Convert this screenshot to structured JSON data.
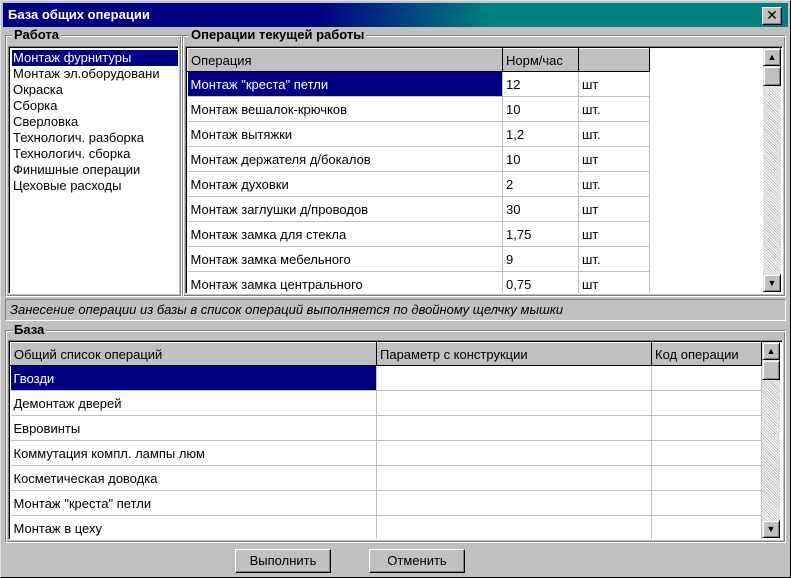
{
  "window": {
    "title": "База общих операции",
    "close_label": "✕"
  },
  "work_group": {
    "title": "Работа",
    "items": [
      "Монтаж фурнитуры",
      "Монтаж эл.оборудовани",
      "Окраска",
      "Сборка",
      "Сверловка",
      "Технологич. разборка",
      "Технологич. сборка",
      "Финишные операции",
      "Цеховые расходы"
    ],
    "selected_index": 0
  },
  "current_ops": {
    "title": "Операции текущей работы",
    "headers": [
      "Операция",
      "Норм/час",
      ""
    ],
    "rows": [
      [
        "Монтаж \"креста\" петли",
        "12",
        "шт"
      ],
      [
        "Монтаж вешалок-крючков",
        "10",
        "шт."
      ],
      [
        "Монтаж вытяжки",
        "1,2",
        "шт."
      ],
      [
        "Монтаж держателя д/бокалов",
        "10",
        "шт"
      ],
      [
        "Монтаж духовки",
        "2",
        "шт."
      ],
      [
        "Монтаж заглушки д/проводов",
        "30",
        "шт"
      ],
      [
        "Монтаж замка для стекла",
        "1,75",
        "шт"
      ],
      [
        "Монтаж замка мебельного",
        "9",
        "шт."
      ],
      [
        "Монтаж замка центрального",
        "0,75",
        "шт"
      ]
    ],
    "selected_row": 0
  },
  "hint": "Занесение операции из базы в список операций выполняется по двойному щелчку мышки",
  "base_group": {
    "title": "База",
    "headers": [
      "Общий список операций",
      "Параметр с конструкции",
      "Код операции"
    ],
    "rows": [
      [
        "Гвозди",
        "",
        ""
      ],
      [
        "Демонтаж дверей",
        "",
        ""
      ],
      [
        "Евровинты",
        "",
        ""
      ],
      [
        "Коммутация компл. лампы люм",
        "",
        ""
      ],
      [
        "Косметическая доводка",
        "",
        ""
      ],
      [
        "Монтаж \"креста\" петли",
        "",
        ""
      ],
      [
        "Монтаж в цеху",
        "",
        ""
      ]
    ],
    "selected_row": 0
  },
  "buttons": {
    "execute": "Выполнить",
    "cancel": "Отменить"
  },
  "scroll_arrows": {
    "up": "▲",
    "down": "▼"
  }
}
